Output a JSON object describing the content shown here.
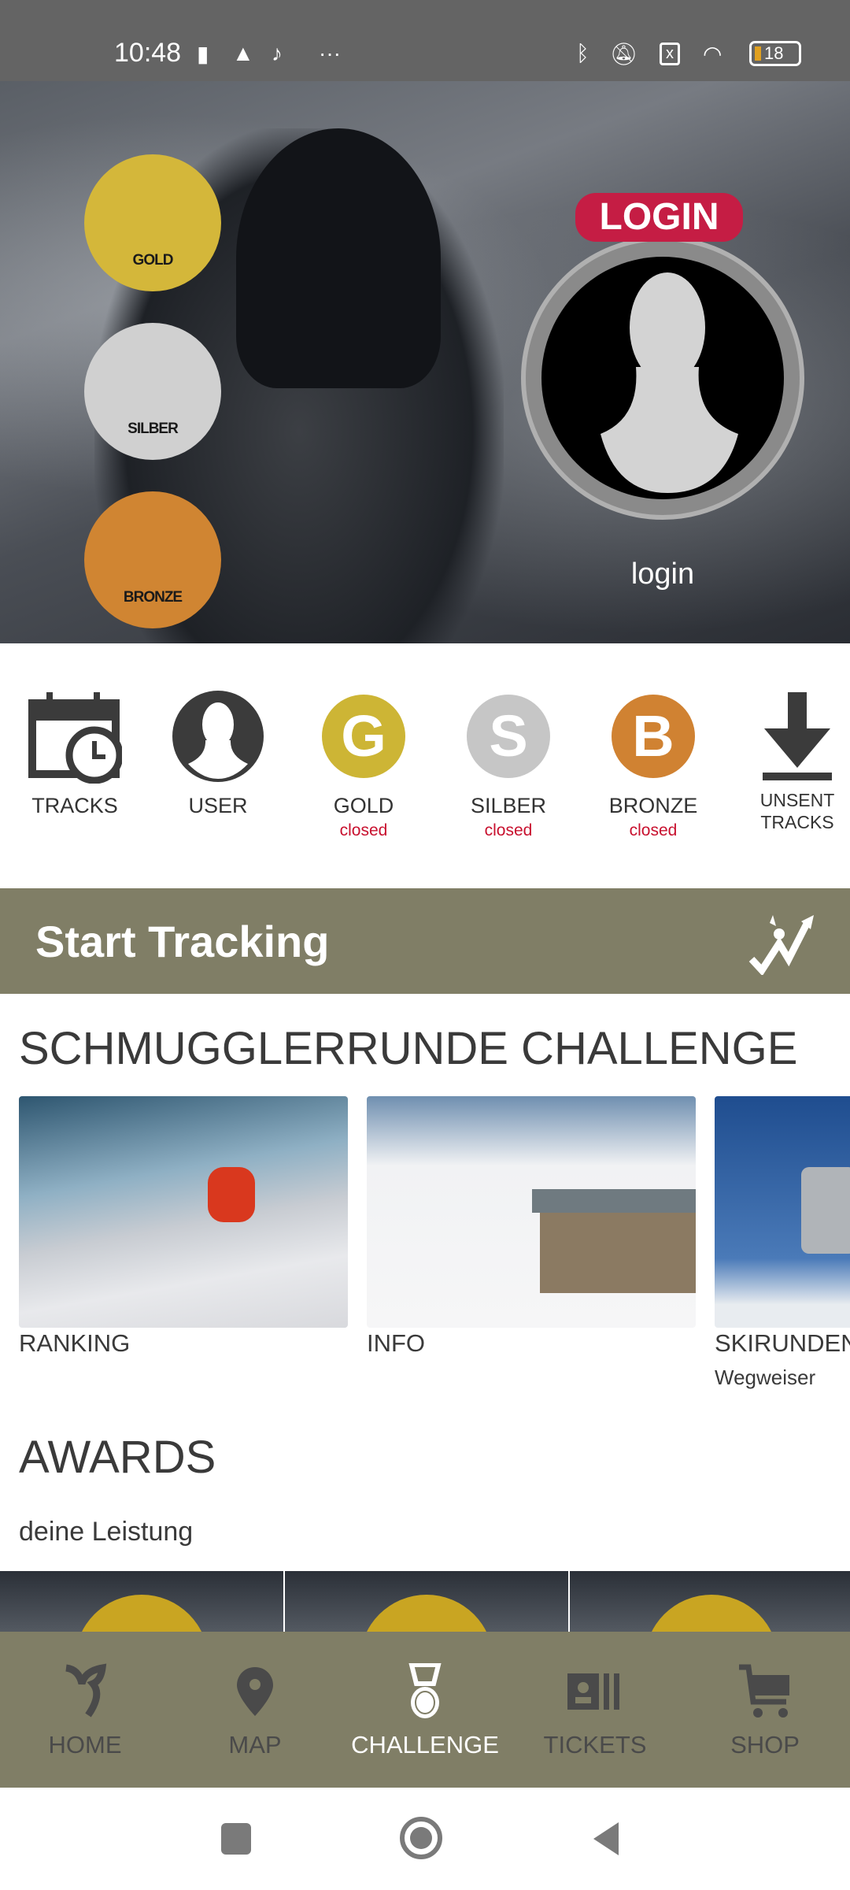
{
  "status_bar": {
    "time": "10:48",
    "battery": "18",
    "accent_battery": "#e0a020"
  },
  "hero": {
    "medals": [
      {
        "label": "GOLD",
        "color": "#d4b73a"
      },
      {
        "label": "SILBER",
        "color": "#d0d0d0"
      },
      {
        "label": "BRONZE",
        "color": "#d08532"
      }
    ],
    "login_badge": "LOGIN",
    "login_text": "login",
    "brand_red": "#c51d44"
  },
  "quick": [
    {
      "label": "TRACKS",
      "icon": "calendar-clock-icon"
    },
    {
      "label": "USER",
      "icon": "user-icon"
    },
    {
      "label": "GOLD",
      "status": "closed",
      "letter": "G",
      "color": "#cdb535"
    },
    {
      "label": "SILBER",
      "status": "closed",
      "letter": "S",
      "color": "#c6c6c6"
    },
    {
      "label": "BRONZE",
      "status": "closed",
      "letter": "B",
      "color": "#d08232"
    },
    {
      "label": "UNSENT\nTRACKS",
      "icon": "download-icon"
    }
  ],
  "start_tracking": {
    "label": "Start Tracking",
    "color": "#807e66"
  },
  "challenge": {
    "title": "SCHMUGGLERRUNDE CHALLENGE",
    "cards": [
      {
        "label": "RANKING"
      },
      {
        "label": "INFO"
      },
      {
        "label": "SKIRUNDEN",
        "sublabel": "Wegweiser"
      }
    ]
  },
  "awards": {
    "title": "AWARDS",
    "subtitle": "deine Leistung"
  },
  "bottom_nav": [
    {
      "label": "HOME"
    },
    {
      "label": "MAP"
    },
    {
      "label": "CHALLENGE",
      "active": true
    },
    {
      "label": "TICKETS"
    },
    {
      "label": "SHOP"
    }
  ]
}
